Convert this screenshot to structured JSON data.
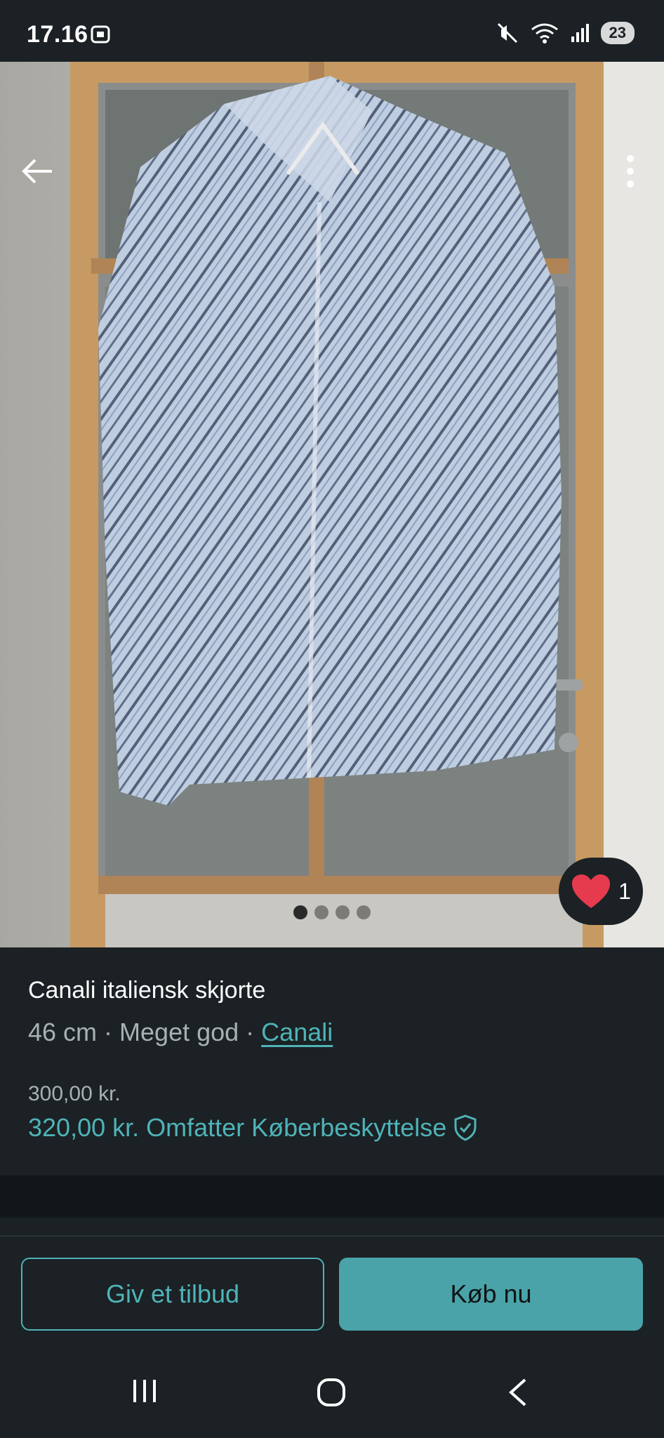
{
  "status_bar": {
    "time": "17.16",
    "battery_level": "23",
    "icons": [
      "screenshot-icon",
      "mute-icon",
      "wifi-icon",
      "signal-icon"
    ]
  },
  "photo": {
    "alt": "Canali italiensk skjorte",
    "page_count": 4,
    "active_page": 1,
    "favorite_count": "1"
  },
  "item": {
    "title": "Canali italiensk skjorte",
    "size": "46 cm",
    "separator": " · ",
    "condition": "Meget god",
    "brand": "Canali",
    "price": "300,00 kr.",
    "price_with_protection": "320,00 kr.",
    "protection_label": "Omfatter Køberbeskyttelse"
  },
  "actions": {
    "offer_label": "Giv et tilbud",
    "buy_label": "Køb nu"
  },
  "colors": {
    "background": "#1b2124",
    "accent": "#4fb3b8",
    "heart": "#e63a4f"
  }
}
